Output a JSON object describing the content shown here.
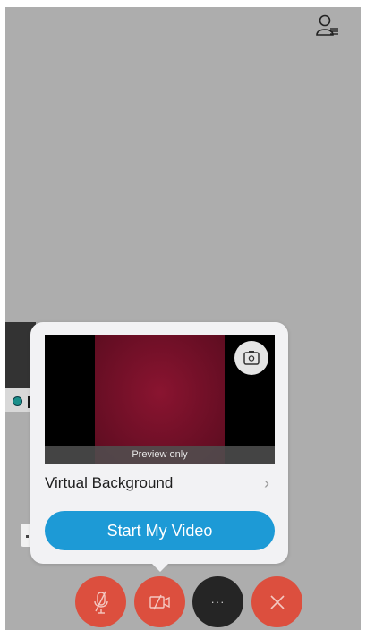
{
  "header": {
    "participants_icon": "participants-list-icon"
  },
  "popover": {
    "preview_caption": "Preview only",
    "virtual_background_label": "Virtual Background",
    "chevron": "›",
    "start_video_label": "Start My Video",
    "switch_camera_icon": "switch-camera-icon"
  },
  "controls": {
    "mute_icon": "microphone-muted-icon",
    "video_icon": "video-off-icon",
    "more_label": "···",
    "leave_icon": "close-icon"
  },
  "colors": {
    "accent": "#1d9ad6",
    "danger": "#dc4f3e",
    "background": "#adadad"
  }
}
